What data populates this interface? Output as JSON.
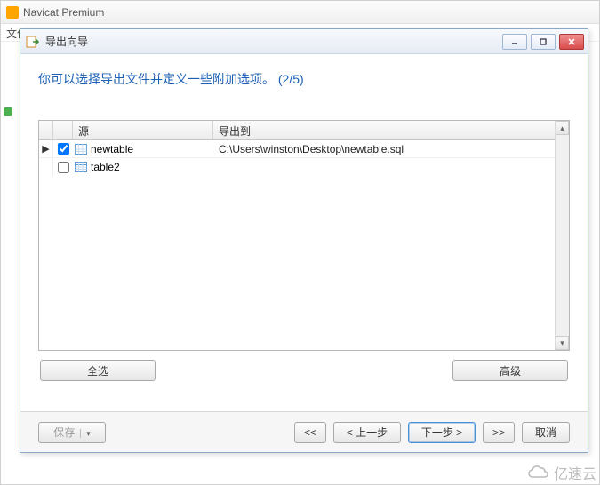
{
  "app": {
    "title": "Navicat Premium",
    "menu_file": "文件"
  },
  "dialog": {
    "title": "导出向导",
    "instruction": "你可以选择导出文件并定义一些附加选项。 (2/5)"
  },
  "grid": {
    "header_source": "源",
    "header_dest": "导出到",
    "rows": [
      {
        "checked": true,
        "current": true,
        "name": "newtable",
        "dest": "C:\\Users\\winston\\Desktop\\newtable.sql"
      },
      {
        "checked": false,
        "current": false,
        "name": "table2",
        "dest": ""
      }
    ]
  },
  "buttons": {
    "select_all": "全选",
    "advanced": "高级",
    "save": "保存",
    "first": "<<",
    "prev": "< 上一步",
    "next": "下一步 >",
    "last": ">>",
    "cancel": "取消"
  },
  "watermark": "亿速云"
}
